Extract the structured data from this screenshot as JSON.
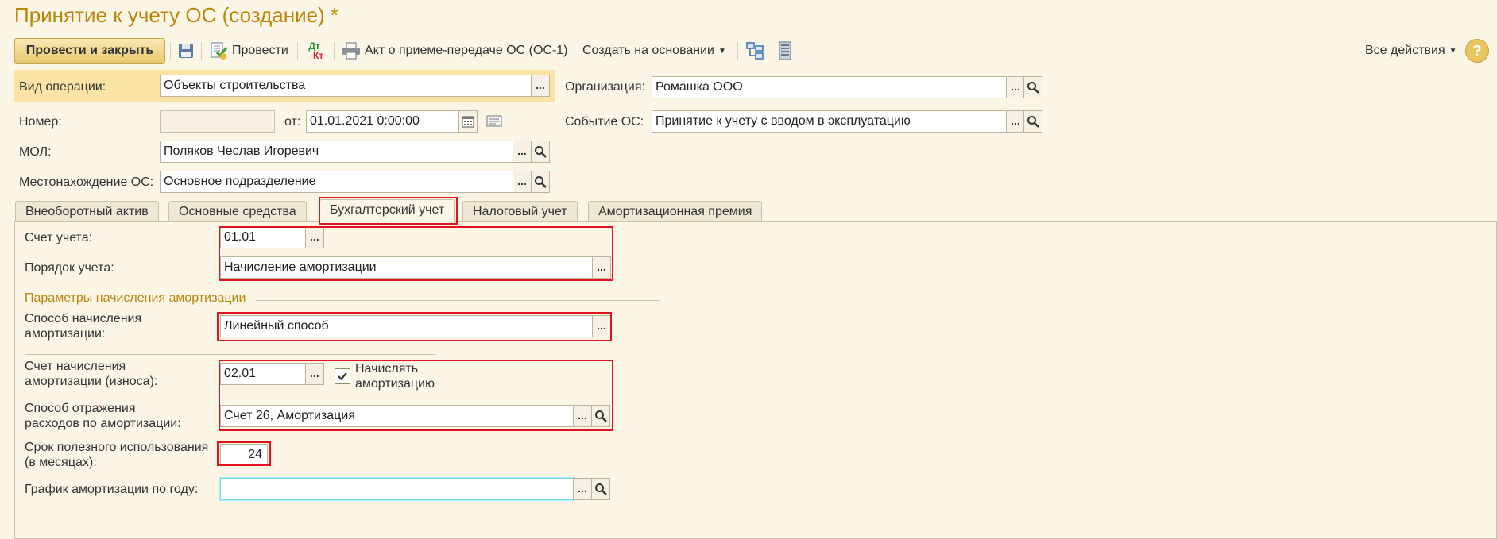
{
  "window": {
    "title": "Принятие к учету ОС (создание) *"
  },
  "toolbar": {
    "post_close": "Провести и закрыть",
    "post": "Провести",
    "dt_kt_top": "Дт",
    "dt_kt_bottom": "Кт",
    "act": "Акт о приеме-передаче ОС (ОС-1)",
    "create_based": "Создать на основании",
    "all_actions": "Все действия",
    "help": "?"
  },
  "form": {
    "operation_label": "Вид операции:",
    "operation_value": "Объекты строительства",
    "number_label": "Номер:",
    "number_value": "",
    "date_label": "от:",
    "date_value": "01.01.2021  0:00:00",
    "mol_label": "МОЛ:",
    "mol_value": "Поляков Чеслав Игоревич",
    "location_label": "Местонахождение ОС:",
    "location_value": "Основное подразделение",
    "org_label": "Организация:",
    "org_value": "Ромашка ООО",
    "event_label": "Событие ОС:",
    "event_value": "Принятие к учету с вводом в эксплуатацию",
    "dots": "..."
  },
  "tabs": [
    {
      "label": "Внеоборотный актив"
    },
    {
      "label": "Основные средства"
    },
    {
      "label": "Бухгалтерский учет"
    },
    {
      "label": "Налоговый учет"
    },
    {
      "label": "Амортизационная премия"
    }
  ],
  "accounting": {
    "account_label": "Счет учета:",
    "account_value": "01.01",
    "order_label": "Порядок учета:",
    "order_value": "Начисление амортизации",
    "params_title": "Параметры начисления амортизации",
    "method_label_1": "Способ начисления",
    "method_label_2": "амортизации:",
    "method_value": "Линейный способ",
    "dep_account_label_1": "Счет начисления",
    "dep_account_label_2": "амортизации (износа):",
    "dep_account_value": "02.01",
    "accrue_label_1": "Начислять",
    "accrue_label_2": "амортизацию",
    "accrue_checked": true,
    "expense_label_1": "Способ отражения",
    "expense_label_2": "расходов по амортизации:",
    "expense_value": "Счет 26, Амортизация",
    "life_label_1": "Срок полезного использования",
    "life_label_2": "(в месяцах):",
    "life_value": "24",
    "schedule_label": "График амортизации по году:",
    "schedule_value": ""
  },
  "colors": {
    "title": "#b8860b",
    "background": "#fbf5e6",
    "highlight": "#e0141e"
  }
}
